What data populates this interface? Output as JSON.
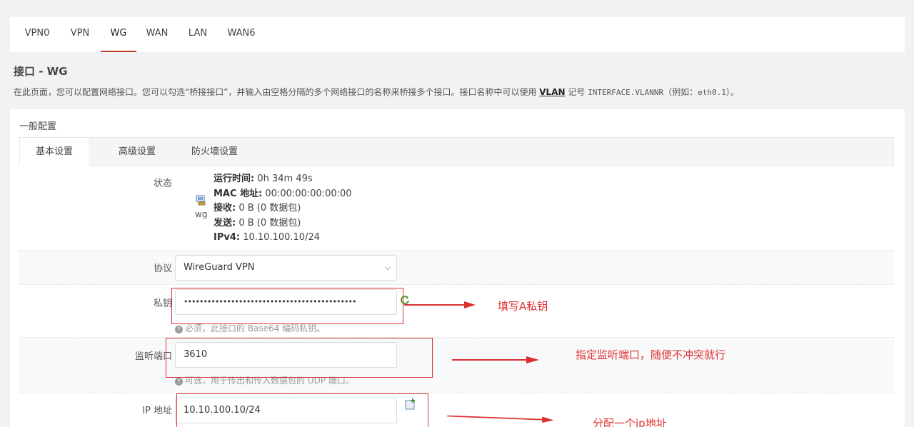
{
  "tabs": [
    {
      "label": "VPN0",
      "active": false
    },
    {
      "label": "VPN",
      "active": false
    },
    {
      "label": "WG",
      "active": true
    },
    {
      "label": "WAN",
      "active": false
    },
    {
      "label": "LAN",
      "active": false
    },
    {
      "label": "WAN6",
      "active": false
    }
  ],
  "page": {
    "title": "接口 - WG",
    "desc_before": "在此页面，您可以配置网络接口。您可以勾选“桥接接口”，并输入由空格分隔的多个网络接口的名称来桥接多个接口。接口名称中可以使用 ",
    "desc_link": "VLAN",
    "desc_mid": " 记号 ",
    "desc_code": "INTERFACE.VLANNR",
    "desc_after": "（例如：",
    "desc_example": "eth0.1",
    "desc_end": "）。"
  },
  "panel": {
    "legend": "一般配置",
    "subtabs": [
      "基本设置",
      "高级设置",
      "防火墙设置"
    ]
  },
  "status": {
    "label": "状态",
    "icon_label": "wg",
    "uptime_key": "运行时间:",
    "uptime_val": " 0h 34m 49s",
    "mac_key": "MAC 地址:",
    "mac_val": " 00:00:00:00:00:00",
    "rx_key": "接收:",
    "rx_val": " 0 B (0 数据包)",
    "tx_key": "发送:",
    "tx_val": " 0 B (0 数据包)",
    "ipv4_key": "IPv4:",
    "ipv4_val": " 10.10.100.10/24"
  },
  "protocol": {
    "label": "协议",
    "value": "WireGuard VPN"
  },
  "private_key": {
    "label": "私钥",
    "value": "••••••••••••••••••••••••••••••••••••••••••••",
    "hint": "必须，此接口的 Base64 编码私钥。"
  },
  "listen_port": {
    "label": "监听端口",
    "value": "3610",
    "hint": "可选，用于传出和传入数据包的 UDP 端口。"
  },
  "ip_address": {
    "label": "IP 地址",
    "value": "10.10.100.10/24"
  },
  "annotations": {
    "private_key": "填写A私钥",
    "listen_port": "指定监听端口，随便不冲突就行",
    "ip_address": "分配一个ip地址"
  },
  "colors": {
    "accent": "#c0392b",
    "annotation": "#e02e2e"
  }
}
